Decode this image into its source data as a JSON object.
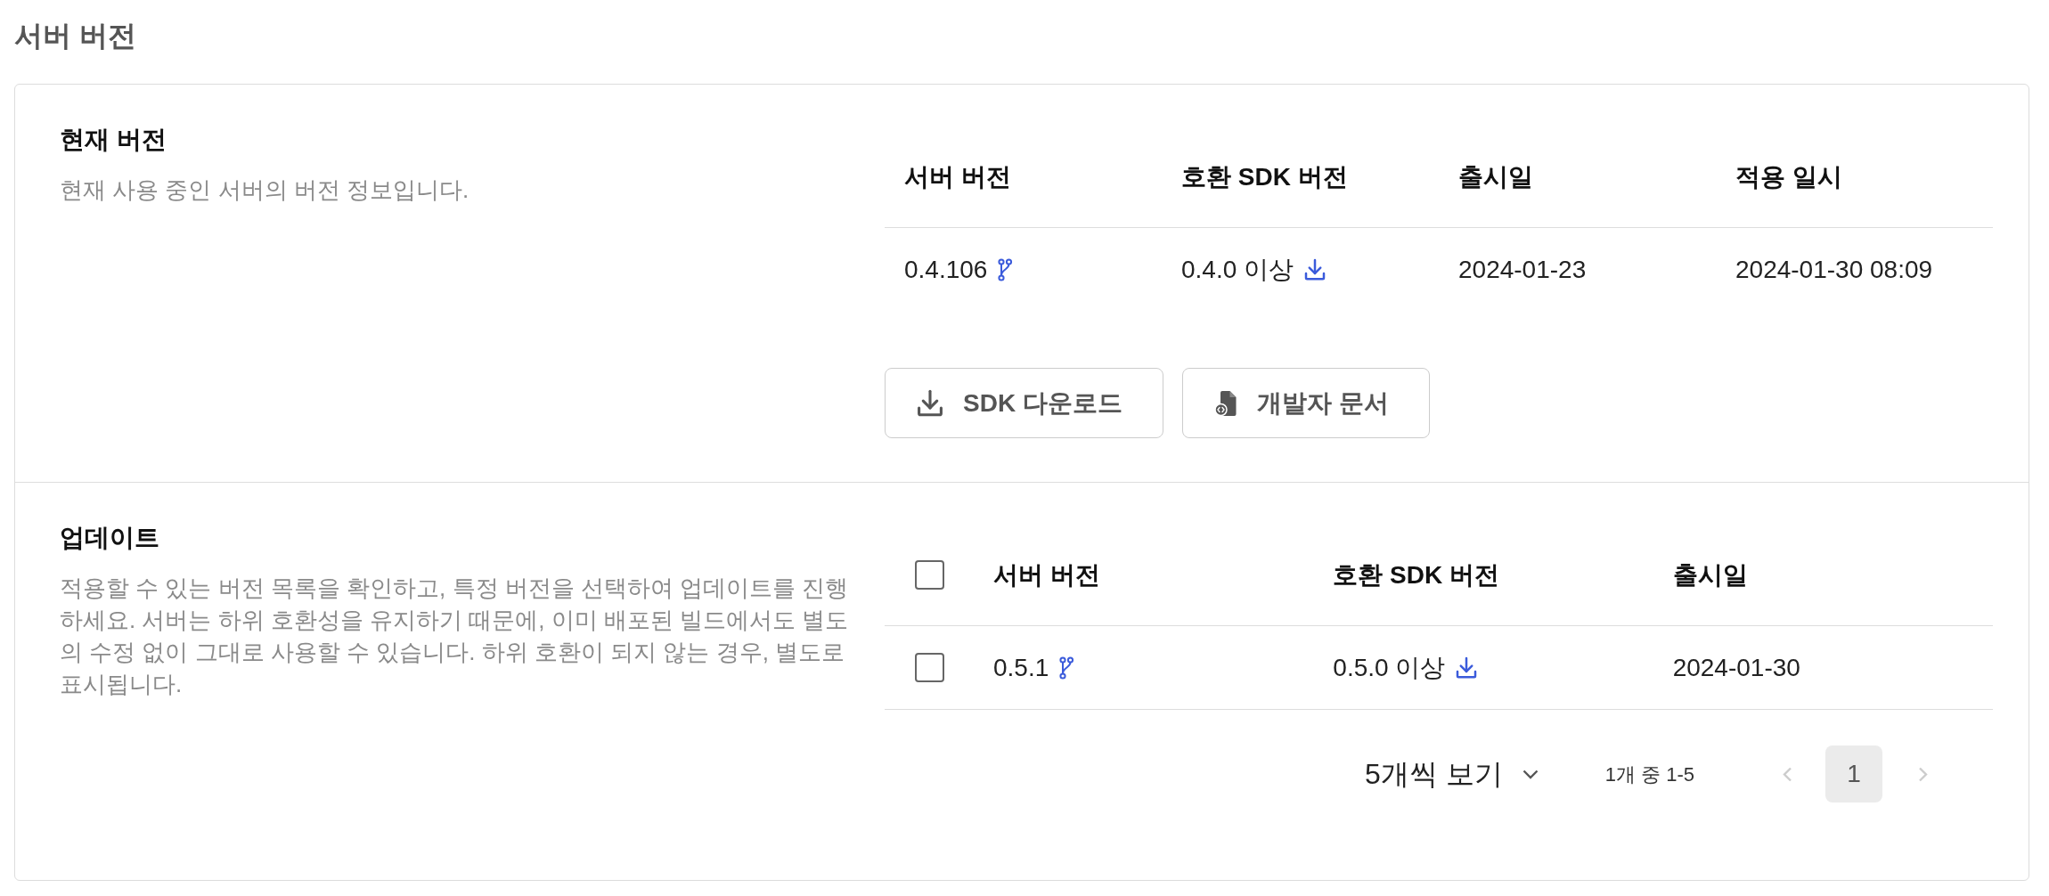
{
  "page": {
    "title": "서버 버전"
  },
  "current_version": {
    "heading": "현재 버전",
    "description": "현재 사용 중인 서버의 버전 정보입니다.",
    "table": {
      "columns": [
        "서버 버전",
        "호환 SDK 버전",
        "출시일",
        "적용 일시"
      ],
      "rows": [
        {
          "server_version": "0.4.106",
          "sdk_version": "0.4.0 이상",
          "release_date": "2024-01-23",
          "applied_at": "2024-01-30 08:09"
        }
      ]
    },
    "buttons": [
      {
        "label": "SDK 다운로드",
        "kind": "download"
      },
      {
        "label": "개발자 문서",
        "kind": "docs"
      }
    ]
  },
  "update": {
    "heading": "업데이트",
    "description": "적용할 수 있는 버전 목록을 확인하고, 특정 버전을 선택하여 업데이트를 진행하세요. 서버는 하위 호환성을 유지하기 때문에, 이미 배포된 빌드에서도 별도의 수정 없이 그대로 사용할 수 있습니다. 하위 호환이 되지 않는 경우, 별도로 표시됩니다.",
    "table": {
      "select_all": {
        "checked": false
      },
      "columns": [
        "서버 버전",
        "호환 SDK 버전",
        "출시일"
      ],
      "rows": [
        {
          "checked": false,
          "server_version": "0.5.1",
          "sdk_version": "0.5.0 이상",
          "release_date": "2024-01-30"
        }
      ]
    },
    "pagination": {
      "page_size": "5개씩 보기",
      "range": "1개 중 1-5",
      "prev": {
        "disabled": true
      },
      "pages": [
        {
          "label": "1",
          "selected": true
        }
      ],
      "next": {
        "disabled": true
      }
    }
  }
}
